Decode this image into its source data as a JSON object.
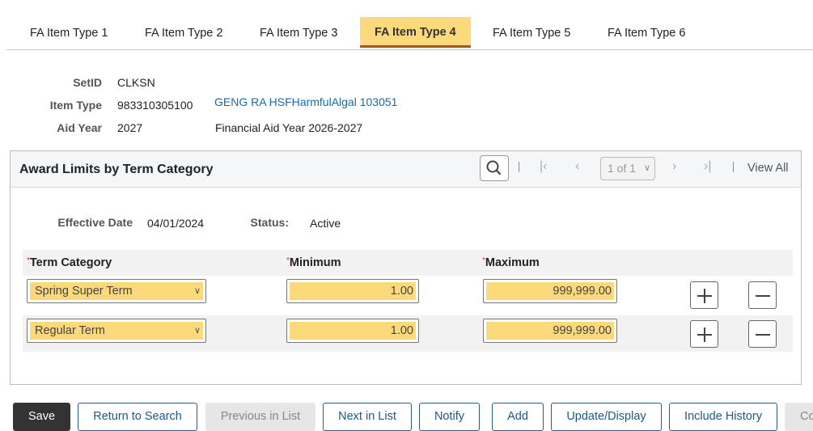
{
  "tabs": [
    {
      "label": "FA Item Type 1"
    },
    {
      "label": "FA Item Type 2"
    },
    {
      "label": "FA Item Type 3"
    },
    {
      "label": "FA Item Type 4",
      "active": true
    },
    {
      "label": "FA Item Type 5"
    },
    {
      "label": "FA Item Type 6"
    }
  ],
  "header": {
    "setid_label": "SetID",
    "setid_value": "CLKSN",
    "item_type_label": "Item Type",
    "item_type_value": "983310305100",
    "item_type_desc": "GENG RA HSFHarmfulAlgal 103051",
    "aid_year_label": "Aid Year",
    "aid_year_value": "2027",
    "aid_year_desc": "Financial Aid Year 2026-2027"
  },
  "grid": {
    "title": "Award Limits by Term Category",
    "pager": "1 of 1",
    "view_all": "View All",
    "effective_date_label": "Effective Date",
    "effective_date_value": "04/01/2024",
    "status_label": "Status:",
    "status_value": "Active",
    "columns": {
      "required_marker": "*",
      "term_category": "Term Category",
      "minimum": "Minimum",
      "maximum": "Maximum"
    },
    "rows": [
      {
        "term_category": "Spring Super Term",
        "minimum": "1.00",
        "maximum": "999,999.00"
      },
      {
        "term_category": "Regular Term",
        "minimum": "1.00",
        "maximum": "999,999.00"
      }
    ]
  },
  "buttons": {
    "save": "Save",
    "return_to_search": "Return to Search",
    "previous_in_list": "Previous in List",
    "next_in_list": "Next in List",
    "notify": "Notify",
    "add": "Add",
    "update_display": "Update/Display",
    "include_history": "Include History",
    "correct_history": "Co"
  },
  "colors": {
    "active_tab": "#fcd97b",
    "active_tab_underline": "#a0552a",
    "required_field": "#fcd97b",
    "link": "#1a6aa8"
  }
}
